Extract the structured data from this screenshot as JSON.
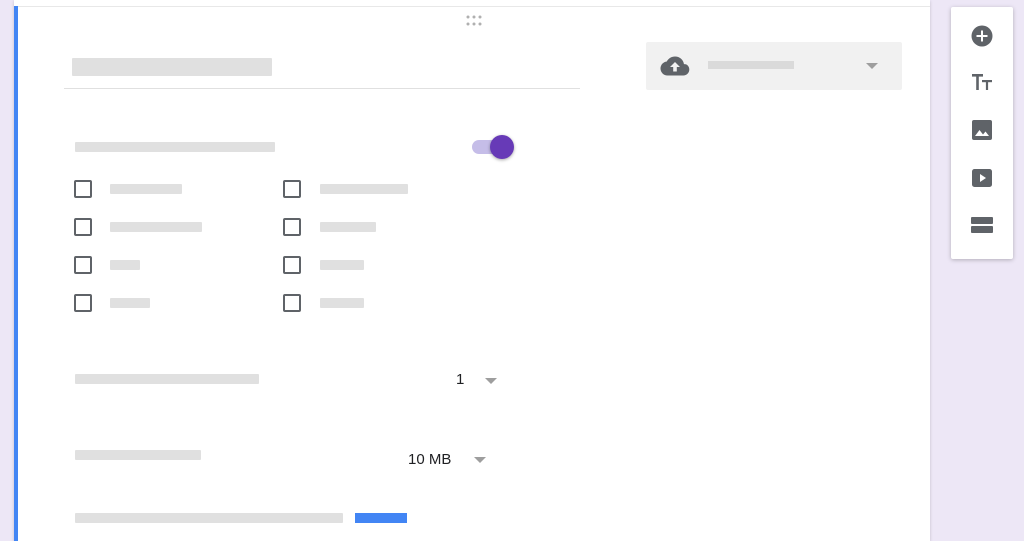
{
  "question_card": {
    "accent_color": "#4285f4",
    "type_selector": {
      "icon": "cloud-upload-icon"
    },
    "toggle": {
      "state": "on",
      "color": "#673ab7"
    },
    "file_types": {
      "checkboxes": [
        {
          "checked": false
        },
        {
          "checked": false
        },
        {
          "checked": false
        },
        {
          "checked": false
        },
        {
          "checked": false
        },
        {
          "checked": false
        },
        {
          "checked": false
        },
        {
          "checked": false
        }
      ]
    },
    "max_files": {
      "value": "1"
    },
    "max_size": {
      "value": "10 MB"
    }
  },
  "sidebar": {
    "buttons": [
      {
        "icon": "add-circle-icon"
      },
      {
        "icon": "text-title-icon",
        "glyph": "TT"
      },
      {
        "icon": "image-icon"
      },
      {
        "icon": "video-icon"
      },
      {
        "icon": "section-icon"
      }
    ]
  }
}
